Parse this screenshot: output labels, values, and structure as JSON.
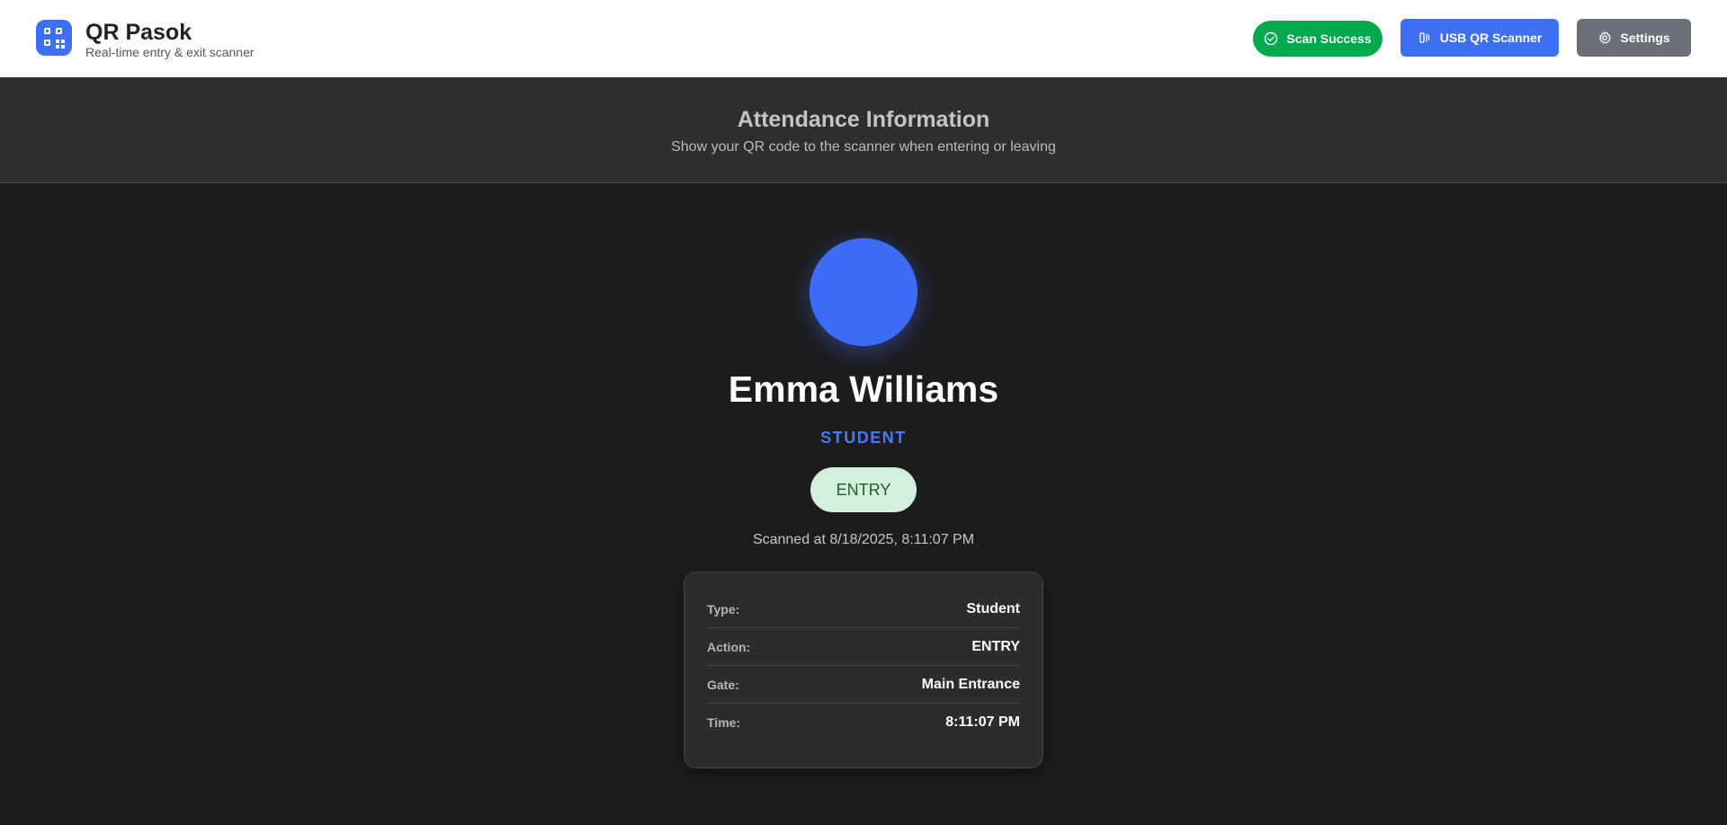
{
  "header": {
    "app_title": "QR Pasok",
    "app_subtitle": "Real-time entry & exit scanner",
    "buttons": {
      "scan_success": "Scan Success",
      "usb_scanner": "USB QR Scanner",
      "settings": "Settings"
    }
  },
  "info_band": {
    "title": "Attendance Information",
    "subtitle": "Show your QR code to the scanner when entering or leaving"
  },
  "person": {
    "name": "Emma Williams",
    "role": "STUDENT",
    "action_badge": "ENTRY",
    "scanned_at": "Scanned at 8/18/2025, 8:11:07 PM"
  },
  "details": [
    {
      "label": "Type:",
      "value": "Student"
    },
    {
      "label": "Action:",
      "value": "ENTRY"
    },
    {
      "label": "Gate:",
      "value": "Main Entrance"
    },
    {
      "label": "Time:",
      "value": "8:11:07 PM"
    }
  ],
  "colors": {
    "accent": "#3e6ff5",
    "success": "#00a84e",
    "settings": "#6b7077",
    "background": "#1c1c1c"
  },
  "icons": [
    "qr-code-icon",
    "check-circle-icon",
    "scanner-icon",
    "gear-icon"
  ]
}
